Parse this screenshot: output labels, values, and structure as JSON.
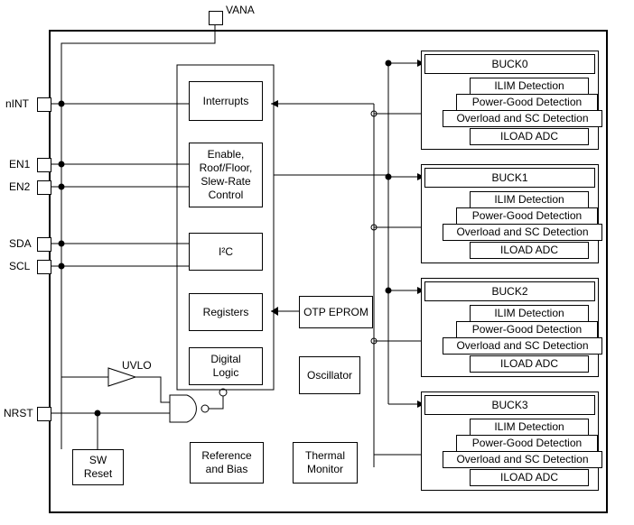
{
  "pins": {
    "top": {
      "vana": "VANA"
    },
    "left": {
      "nint": "nINT",
      "en1": "EN1",
      "en2": "EN2",
      "sda": "SDA",
      "scl": "SCL",
      "nrst": "NRST"
    }
  },
  "center": {
    "interrupts": "Interrupts",
    "enable": "Enable,\nRoof/Floor,\nSlew-Rate\nControl",
    "i2c": "I²C",
    "registers": "Registers",
    "digitallogic": "Digital\nLogic",
    "otp": "OTP EPROM",
    "oscillator": "Oscillator",
    "refbias": "Reference\nand Bias",
    "thermal": "Thermal\nMonitor",
    "uvlo": "UVLO",
    "swreset": "SW\nReset"
  },
  "bucks": [
    {
      "title": "BUCK0",
      "ilim": "ILIM Detection",
      "pg": "Power-Good Detection",
      "ovl": "Overload and SC Detection",
      "iload": "ILOAD ADC"
    },
    {
      "title": "BUCK1",
      "ilim": "ILIM Detection",
      "pg": "Power-Good Detection",
      "ovl": "Overload and SC Detection",
      "iload": "ILOAD ADC"
    },
    {
      "title": "BUCK2",
      "ilim": "ILIM Detection",
      "pg": "Power-Good Detection",
      "ovl": "Overload and SC Detection",
      "iload": "ILOAD ADC"
    },
    {
      "title": "BUCK3",
      "ilim": "ILIM Detection",
      "pg": "Power-Good Detection",
      "ovl": "Overload and SC Detection",
      "iload": "ILOAD ADC"
    }
  ]
}
